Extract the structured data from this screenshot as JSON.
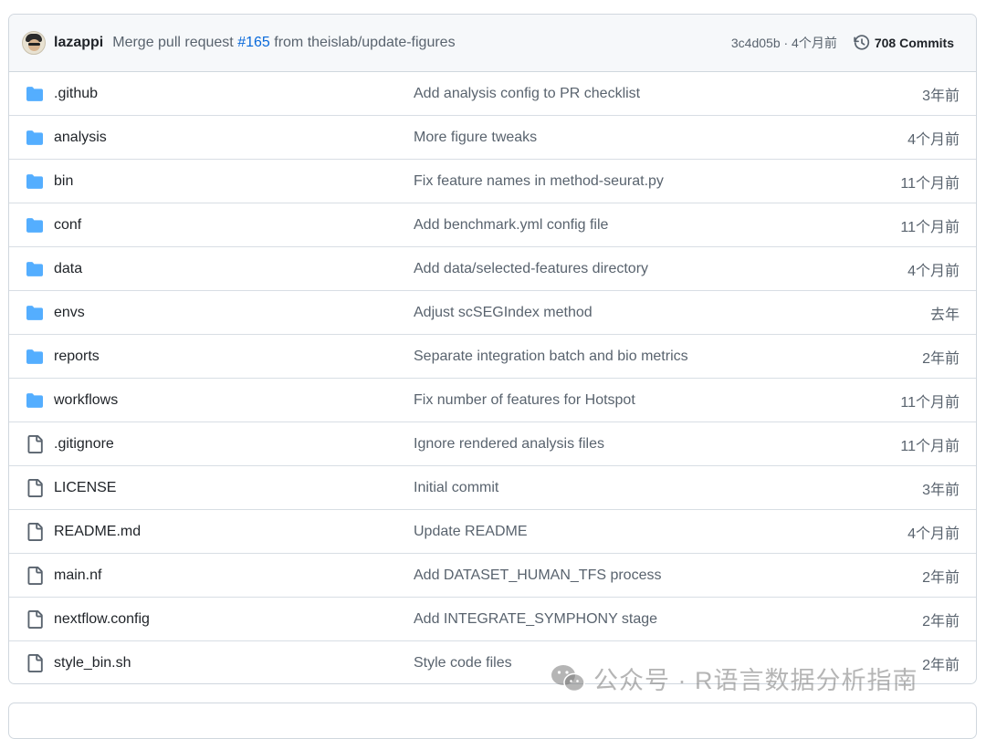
{
  "commit": {
    "author": "lazappi",
    "message_prefix": "Merge pull request ",
    "pr_number": "#165",
    "message_suffix": " from theislab/update-figures",
    "sha_time": "3c4d05b · 4个月前",
    "commits_label": "708 Commits"
  },
  "files": [
    {
      "name": ".github",
      "type": "folder",
      "message": "Add analysis config to PR checklist",
      "time": "3年前"
    },
    {
      "name": "analysis",
      "type": "folder",
      "message": "More figure tweaks",
      "time": "4个月前"
    },
    {
      "name": "bin",
      "type": "folder",
      "message": "Fix feature names in method-seurat.py",
      "time": "11个月前"
    },
    {
      "name": "conf",
      "type": "folder",
      "message": "Add benchmark.yml config file",
      "time": "11个月前"
    },
    {
      "name": "data",
      "type": "folder",
      "message": "Add data/selected-features directory",
      "time": "4个月前"
    },
    {
      "name": "envs",
      "type": "folder",
      "message": "Adjust scSEGIndex method",
      "time": "去年"
    },
    {
      "name": "reports",
      "type": "folder",
      "message": "Separate integration batch and bio metrics",
      "time": "2年前"
    },
    {
      "name": "workflows",
      "type": "folder",
      "message": "Fix number of features for Hotspot",
      "time": "11个月前"
    },
    {
      "name": ".gitignore",
      "type": "file",
      "message": "Ignore rendered analysis files",
      "time": "11个月前"
    },
    {
      "name": "LICENSE",
      "type": "file",
      "message": "Initial commit",
      "time": "3年前"
    },
    {
      "name": "README.md",
      "type": "file",
      "message": "Update README",
      "time": "4个月前"
    },
    {
      "name": "main.nf",
      "type": "file",
      "message": "Add DATASET_HUMAN_TFS process",
      "time": "2年前"
    },
    {
      "name": "nextflow.config",
      "type": "file",
      "message": "Add INTEGRATE_SYMPHONY stage",
      "time": "2年前"
    },
    {
      "name": "style_bin.sh",
      "type": "file",
      "message": "Style code files",
      "time": "2年前"
    }
  ],
  "watermark": "公众号 · R语言数据分析指南",
  "colors": {
    "folder": "#54aeff",
    "link": "#0969da",
    "muted": "#59636e"
  }
}
